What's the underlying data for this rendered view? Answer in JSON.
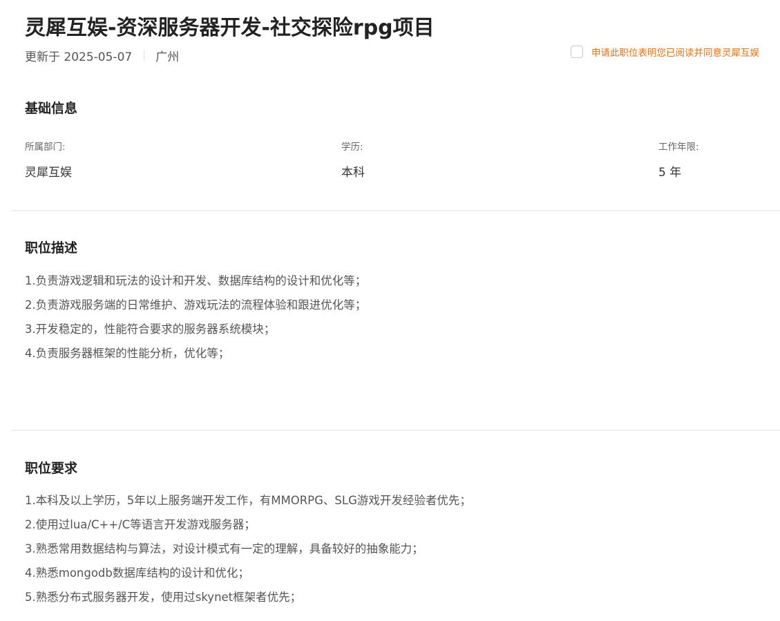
{
  "job": {
    "title": "灵犀互娱-资深服务器开发-社交探险rpg项目",
    "updated": "更新于 2025-05-07",
    "location": "广州"
  },
  "consent": {
    "text": "申请此职位表明您已阅读并同意灵犀互娱",
    "checked": false
  },
  "basic_info": {
    "title": "基础信息",
    "fields": [
      {
        "label": "所属部门:",
        "value": "灵犀互娱"
      },
      {
        "label": "学历:",
        "value": "本科"
      },
      {
        "label": "工作年限:",
        "value": "5 年"
      }
    ]
  },
  "description": {
    "title": "职位描述",
    "items": [
      "1.负责游戏逻辑和玩法的设计和开发、数据库结构的设计和优化等；",
      "2.负责游戏服务端的日常维护、游戏玩法的流程体验和跟进优化等；",
      "3.开发稳定的，性能符合要求的服务器系统模块；",
      "4.负责服务器框架的性能分析，优化等；"
    ]
  },
  "requirements": {
    "title": "职位要求",
    "items": [
      "1.本科及以上学历，5年以上服务端开发工作，有MMORPG、SLG游戏开发经验者优先；",
      "2.使用过lua/C++/C等语言开发游戏服务器；",
      "3.熟悉常用数据结构与算法，对设计模式有一定的理解，具备较好的抽象能力；",
      "4.熟悉mongodb数据库结构的设计和优化；",
      "5.熟悉分布式服务器开发，使用过skynet框架者优先；"
    ]
  },
  "colors": {
    "accent": "#e8700d",
    "title": "#222222",
    "body": "#555555",
    "divider": "#f0f0f0"
  }
}
